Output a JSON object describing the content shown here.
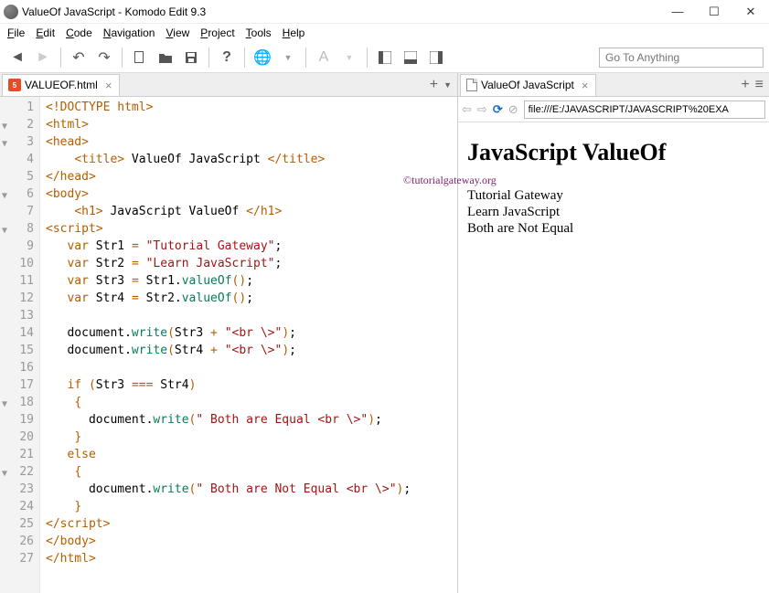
{
  "window": {
    "title": "ValueOf JavaScript - Komodo Edit 9.3"
  },
  "menubar": [
    "File",
    "Edit",
    "Code",
    "Navigation",
    "View",
    "Project",
    "Tools",
    "Help"
  ],
  "toolbar": {
    "goto_placeholder": "Go To Anything"
  },
  "editor": {
    "tab_label": "VALUEOF.html",
    "lines": [
      {
        "n": 1,
        "fold": "",
        "html": "<span class='c-tag'>&lt;!DOCTYPE html&gt;</span>"
      },
      {
        "n": 2,
        "fold": "▼",
        "html": "<span class='c-tag'>&lt;html&gt;</span>"
      },
      {
        "n": 3,
        "fold": "▼",
        "html": "<span class='c-tag'>&lt;head&gt;</span>"
      },
      {
        "n": 4,
        "fold": "",
        "html": "    <span class='c-tag'>&lt;title&gt;</span> ValueOf JavaScript <span class='c-tag'>&lt;/title&gt;</span>"
      },
      {
        "n": 5,
        "fold": "",
        "html": "<span class='c-tag'>&lt;/head&gt;</span>"
      },
      {
        "n": 6,
        "fold": "▼",
        "html": "<span class='c-tag'>&lt;body&gt;</span>"
      },
      {
        "n": 7,
        "fold": "",
        "html": "    <span class='c-tag'>&lt;h1&gt;</span> JavaScript ValueOf <span class='c-tag'>&lt;/h1&gt;</span>"
      },
      {
        "n": 8,
        "fold": "▼",
        "html": "<span class='c-tag'>&lt;script&gt;</span>"
      },
      {
        "n": 9,
        "fold": "",
        "html": "   <span class='c-kw'>var</span> Str1 <span class='c-op'>=</span> <span class='c-str'>\"Tutorial Gateway\"</span>;"
      },
      {
        "n": 10,
        "fold": "",
        "html": "   <span class='c-kw'>var</span> Str2 <span class='c-op'>=</span> <span class='c-str'>\"Learn JavaScript\"</span>;"
      },
      {
        "n": 11,
        "fold": "",
        "html": "   <span class='c-kw'>var</span> Str3 <span class='c-op'>=</span> Str1.<span class='c-func'>valueOf</span><span class='c-op'>(</span><span class='c-op'>)</span>;"
      },
      {
        "n": 12,
        "fold": "",
        "html": "   <span class='c-kw'>var</span> Str4 <span class='c-op'>=</span> Str2.<span class='c-func'>valueOf</span><span class='c-op'>(</span><span class='c-op'>)</span>;"
      },
      {
        "n": 13,
        "fold": "",
        "html": ""
      },
      {
        "n": 14,
        "fold": "",
        "html": "   document.<span class='c-func'>write</span><span class='c-op'>(</span>Str3 <span class='c-op'>+</span> <span class='c-str'>\"&lt;br \\&gt;\"</span><span class='c-op'>)</span>;"
      },
      {
        "n": 15,
        "fold": "",
        "html": "   document.<span class='c-func'>write</span><span class='c-op'>(</span>Str4 <span class='c-op'>+</span> <span class='c-str'>\"&lt;br \\&gt;\"</span><span class='c-op'>)</span>;"
      },
      {
        "n": 16,
        "fold": "",
        "html": ""
      },
      {
        "n": 17,
        "fold": "",
        "html": "   <span class='c-kw'>if</span> <span class='c-op'>(</span>Str3 <span class='c-op'>===</span> Str4<span class='c-op'>)</span>"
      },
      {
        "n": 18,
        "fold": "▼",
        "html": "    <span class='c-op'>{</span>"
      },
      {
        "n": 19,
        "fold": "",
        "html": "      document.<span class='c-func'>write</span><span class='c-op'>(</span><span class='c-str'>\" Both are Equal &lt;br \\&gt;\"</span><span class='c-op'>)</span>;"
      },
      {
        "n": 20,
        "fold": "",
        "html": "    <span class='c-op'>}</span>"
      },
      {
        "n": 21,
        "fold": "",
        "html": "   <span class='c-kw'>else</span>"
      },
      {
        "n": 22,
        "fold": "▼",
        "html": "    <span class='c-op'>{</span>"
      },
      {
        "n": 23,
        "fold": "",
        "html": "      document.<span class='c-func'>write</span><span class='c-op'>(</span><span class='c-str'>\" Both are Not Equal &lt;br \\&gt;\"</span><span class='c-op'>)</span>;"
      },
      {
        "n": 24,
        "fold": "",
        "html": "    <span class='c-op'>}</span>"
      },
      {
        "n": 25,
        "fold": "",
        "html": "<span class='c-tag'>&lt;/script&gt;</span>"
      },
      {
        "n": 26,
        "fold": "",
        "html": "<span class='c-tag'>&lt;/body&gt;</span>"
      },
      {
        "n": 27,
        "fold": "",
        "html": "<span class='c-tag'>&lt;/html&gt;</span>"
      }
    ]
  },
  "browser": {
    "tab_label": "ValueOf JavaScript",
    "url": "file:///E:/JAVASCRIPT/JAVASCRIPT%20EXA",
    "heading": "JavaScript ValueOf",
    "watermark": "©tutorialgateway.org",
    "output": [
      "Tutorial Gateway",
      "Learn JavaScript",
      "Both are Not Equal"
    ]
  }
}
